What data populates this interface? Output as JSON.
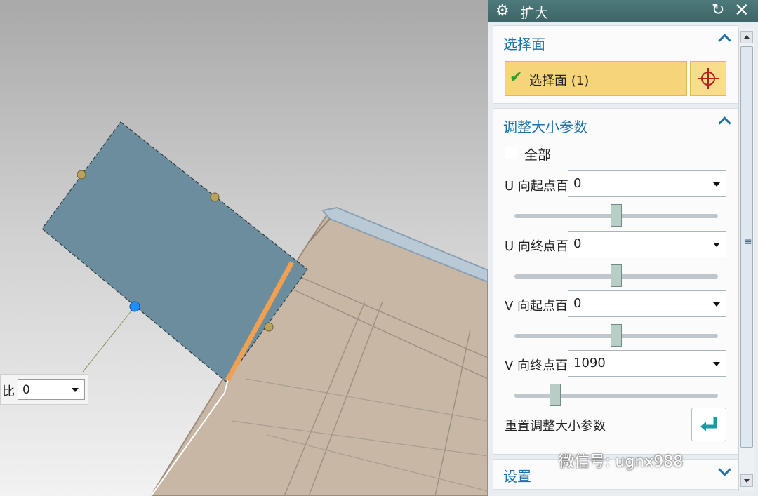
{
  "viewport": {
    "onscreen_input": {
      "label": "比",
      "value": "0"
    }
  },
  "dialog": {
    "title": "扩大",
    "icons": {
      "settings": "gear-icon",
      "reset": "reset-icon",
      "close": "close-icon"
    },
    "section_select": {
      "header": "选择面",
      "selection_label": "选择面 (1)",
      "status": "checkmark-icon",
      "target_icon": "crosshair-icon"
    },
    "section_resize": {
      "header": "调整大小参数",
      "all_checkbox": {
        "label": "全部",
        "checked": false
      },
      "params": [
        {
          "label": "U 向起点百分比",
          "value": "0",
          "slider_fraction": 0.5
        },
        {
          "label": "U 向终点百分比",
          "value": "0",
          "slider_fraction": 0.5
        },
        {
          "label": "V 向起点百分比",
          "value": "0",
          "slider_fraction": 0.5
        },
        {
          "label": "V 向终点百分比",
          "value": "1090",
          "slider_fraction": 0.2
        }
      ],
      "reset_label": "重置调整大小参数"
    },
    "section_settings": {
      "header": "设置"
    }
  },
  "watermark": "微信号: ugnx988",
  "colors": {
    "accent": "#1f6fa8",
    "selection_highlight": "#f6d57a",
    "titlebar": "#4d7a7c",
    "sheet": "#6b8d9e",
    "edge_highlight": "#f0a050",
    "part": "#c9b7a5"
  }
}
